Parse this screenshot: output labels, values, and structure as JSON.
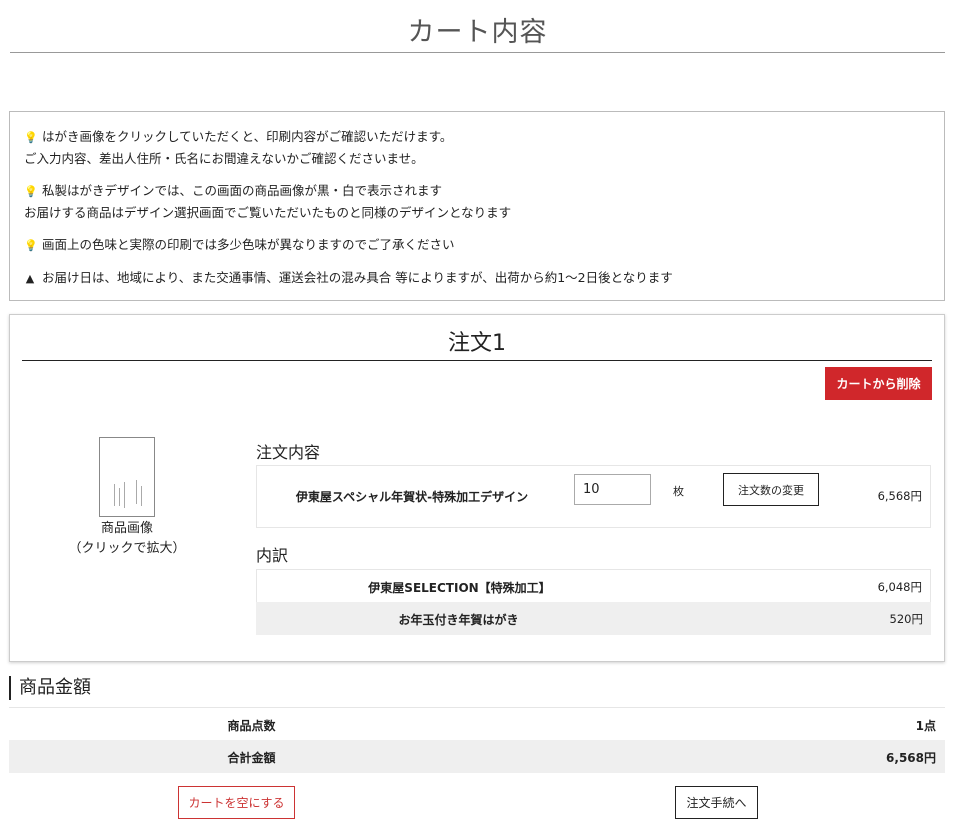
{
  "page": {
    "title": "カート内容"
  },
  "notices": [
    {
      "icon": "lightbulb-icon",
      "glyph": "💡",
      "lines": [
        "はがき画像をクリックしていただくと、印刷内容がご確認いただけます。",
        "ご入力内容、差出人住所・氏名にお間違えないかご確認くださいませ。"
      ]
    },
    {
      "icon": "lightbulb-icon",
      "glyph": "💡",
      "lines": [
        "私製はがきデザインでは、この画面の商品画像が黒・白で表示されます",
        "お届けする商品はデザイン選択画面でご覧いただいたものと同様のデザインとなります"
      ]
    },
    {
      "icon": "lightbulb-icon",
      "glyph": "💡",
      "lines": [
        "画面上の色味と実際の印刷では多少色味が異なりますのでご了承ください"
      ]
    },
    {
      "icon": "warning-icon",
      "glyph": "▲",
      "lines": [
        "お届け日は、地域により、また交通事情、運送会社の混み具合 等によりますが、出荷から約1～2日後となります"
      ]
    }
  ],
  "order": {
    "title": "注文1",
    "delete_label": "カートから削除",
    "thumbnail_caption_1": "商品画像",
    "thumbnail_caption_2": "（クリックで拡大）",
    "content_label": "注文内容",
    "product_name": "伊東屋スペシャル年賀状-特殊加工デザイン",
    "quantity": "10",
    "unit": "枚",
    "change_label": "注文数の変更",
    "price": "6,568円",
    "breakdown_label": "内訳",
    "breakdown": [
      {
        "name": "伊東屋SELECTION【特殊加工】",
        "price": "6,048円"
      },
      {
        "name": "お年玉付き年賀はがき",
        "price": "520円"
      }
    ]
  },
  "summary": {
    "title": "商品金額",
    "count_label": "商品点数",
    "count_value": "1点",
    "total_label": "合計金額",
    "total_value": "6,568円"
  },
  "actions": {
    "empty_cart": "カートを空にする",
    "checkout": "注文手続へ"
  }
}
